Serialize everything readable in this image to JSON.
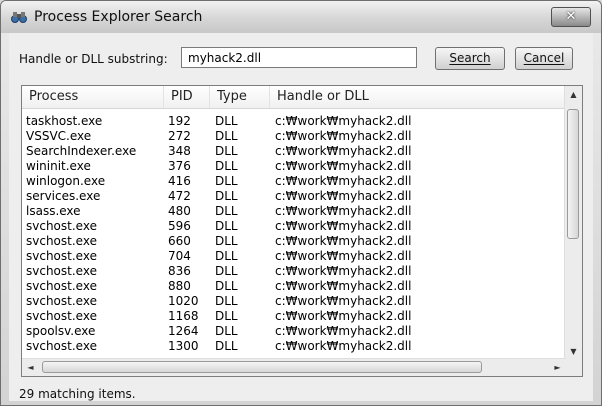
{
  "window": {
    "title": "Process Explorer Search",
    "close_glyph": "✕"
  },
  "search": {
    "label": "Handle or DLL substring:",
    "value": "myhack2.dll",
    "search_button": "Search",
    "cancel_button": "Cancel"
  },
  "table": {
    "columns": [
      "Process",
      "PID",
      "Type",
      "Handle or DLL"
    ],
    "sort_indicator": "^",
    "rows": [
      [
        "taskhost.exe",
        "192",
        "DLL",
        "c:₩work₩myhack2.dll"
      ],
      [
        "VSSVC.exe",
        "272",
        "DLL",
        "c:₩work₩myhack2.dll"
      ],
      [
        "SearchIndexer.exe",
        "348",
        "DLL",
        "c:₩work₩myhack2.dll"
      ],
      [
        "wininit.exe",
        "376",
        "DLL",
        "c:₩work₩myhack2.dll"
      ],
      [
        "winlogon.exe",
        "416",
        "DLL",
        "c:₩work₩myhack2.dll"
      ],
      [
        "services.exe",
        "472",
        "DLL",
        "c:₩work₩myhack2.dll"
      ],
      [
        "lsass.exe",
        "480",
        "DLL",
        "c:₩work₩myhack2.dll"
      ],
      [
        "svchost.exe",
        "596",
        "DLL",
        "c:₩work₩myhack2.dll"
      ],
      [
        "svchost.exe",
        "660",
        "DLL",
        "c:₩work₩myhack2.dll"
      ],
      [
        "svchost.exe",
        "704",
        "DLL",
        "c:₩work₩myhack2.dll"
      ],
      [
        "svchost.exe",
        "836",
        "DLL",
        "c:₩work₩myhack2.dll"
      ],
      [
        "svchost.exe",
        "880",
        "DLL",
        "c:₩work₩myhack2.dll"
      ],
      [
        "svchost.exe",
        "1020",
        "DLL",
        "c:₩work₩myhack2.dll"
      ],
      [
        "svchost.exe",
        "1168",
        "DLL",
        "c:₩work₩myhack2.dll"
      ],
      [
        "spoolsv.exe",
        "1264",
        "DLL",
        "c:₩work₩myhack2.dll"
      ],
      [
        "svchost.exe",
        "1300",
        "DLL",
        "c:₩work₩myhack2.dll"
      ]
    ]
  },
  "status": {
    "text": "29 matching items."
  },
  "icons": {
    "app": "binoculars-icon",
    "close": "close-icon",
    "scroll_up": "arrow-up-icon",
    "scroll_down": "arrow-down-icon",
    "scroll_left": "arrow-left-icon",
    "scroll_right": "arrow-right-icon"
  }
}
